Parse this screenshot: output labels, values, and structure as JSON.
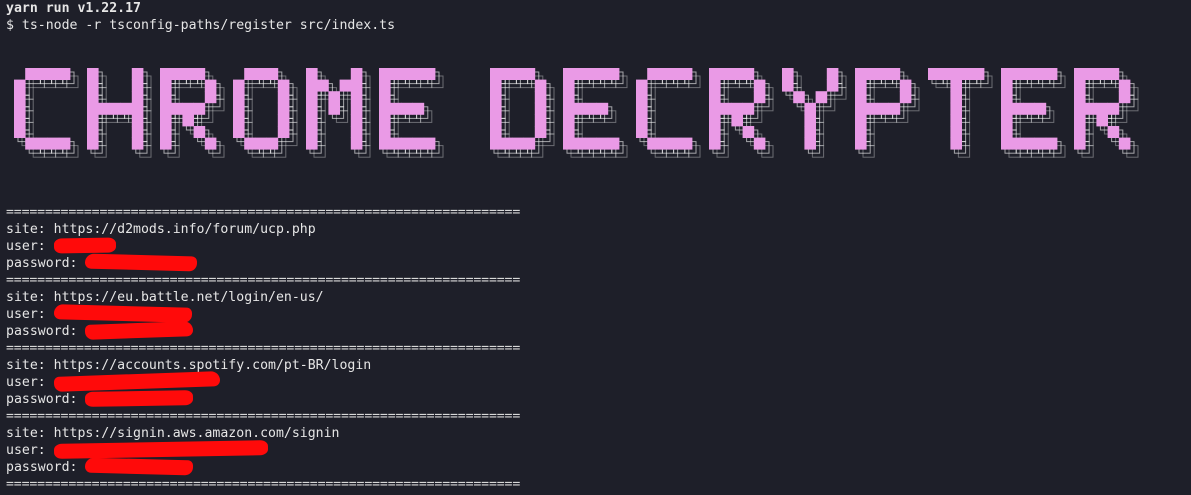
{
  "terminal": {
    "header_line": "yarn run v1.22.17",
    "command_line": "$ ts-node -r tsconfig-paths/register src/index.ts",
    "banner_text": "CHROME DECRYPTER",
    "separator": "==================================================================",
    "colors": {
      "background": "#1e1f29",
      "foreground": "#e6e6e6",
      "banner_fill": "#ea9ae6",
      "redaction": "#ff0a0a"
    },
    "labels": {
      "site": "site: ",
      "user": "user: ",
      "password": "password: "
    },
    "entries": [
      {
        "site": "https://d2mods.info/forum/ucp.php",
        "user": "[redacted]",
        "password": "[redacted]"
      },
      {
        "site": "https://eu.battle.net/login/en-us/",
        "user": "[redacted]",
        "password": "[redacted]"
      },
      {
        "site": "https://accounts.spotify.com/pt-BR/login",
        "user": "[redacted]",
        "password": "[redacted]"
      },
      {
        "site": "https://signin.aws.amazon.com/signin",
        "user": "[redacted]",
        "password": "[redacted]"
      }
    ]
  }
}
